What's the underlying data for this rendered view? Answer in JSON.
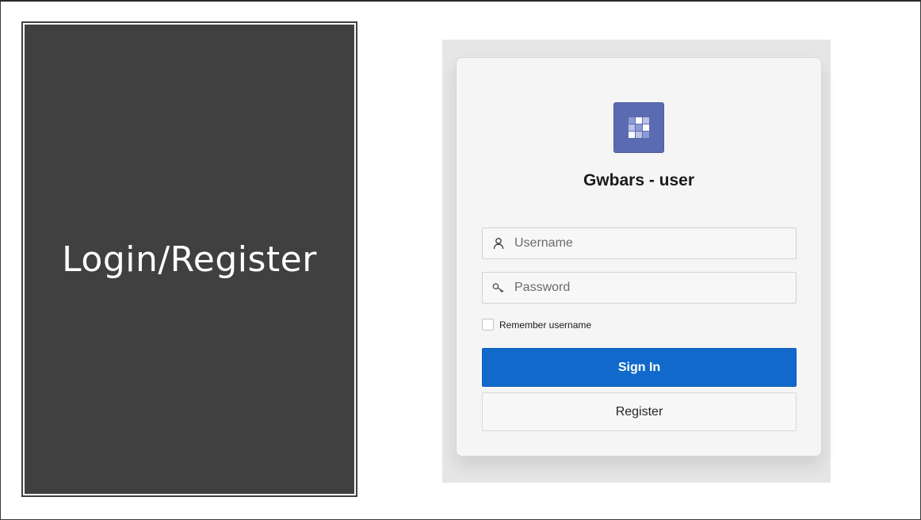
{
  "slide": {
    "left_panel_title": "Login/Register"
  },
  "login": {
    "app_title": "Gwbars - user",
    "logo_icon": "grid-app-icon",
    "username": {
      "placeholder": "Username",
      "value": "",
      "icon": "user-icon"
    },
    "password": {
      "placeholder": "Password",
      "value": "",
      "icon": "key-icon"
    },
    "remember_label": "Remember username",
    "remember_checked": false,
    "sign_in_label": "Sign In",
    "register_label": "Register"
  },
  "colors": {
    "left_panel_bg": "#404040",
    "logo_bg": "#5b6bb2",
    "primary_button": "#116acb",
    "card_bg": "#f5f5f5",
    "backdrop": "#e6e6e6"
  }
}
